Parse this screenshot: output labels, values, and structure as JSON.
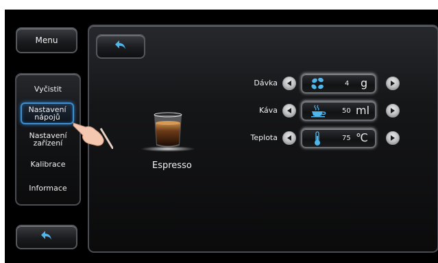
{
  "sidebar": {
    "menu_label": "Menu",
    "items": [
      {
        "label": "Vyčistit"
      },
      {
        "label": "Nastavení nápojů",
        "line1": "Nastavení",
        "line2": "nápojů",
        "active": true
      },
      {
        "label": "Nastavení zařízení",
        "line1": "Nastavení",
        "line2": "zařízení"
      },
      {
        "label": "Kalibrace"
      },
      {
        "label": "Informace"
      }
    ]
  },
  "drink": {
    "name": "Espresso"
  },
  "params": [
    {
      "label": "Dávka",
      "value": "4",
      "unit": "g",
      "icon": "coffee-beans-icon"
    },
    {
      "label": "Káva",
      "value": "50",
      "unit": "ml",
      "icon": "coffee-cup-icon"
    },
    {
      "label": "Teplota",
      "value": "75",
      "unit": "℃",
      "icon": "thermometer-icon"
    }
  ],
  "colors": {
    "accent": "#3d8fd0",
    "icon_blue": "#4fb6ec",
    "background": "#000000"
  }
}
